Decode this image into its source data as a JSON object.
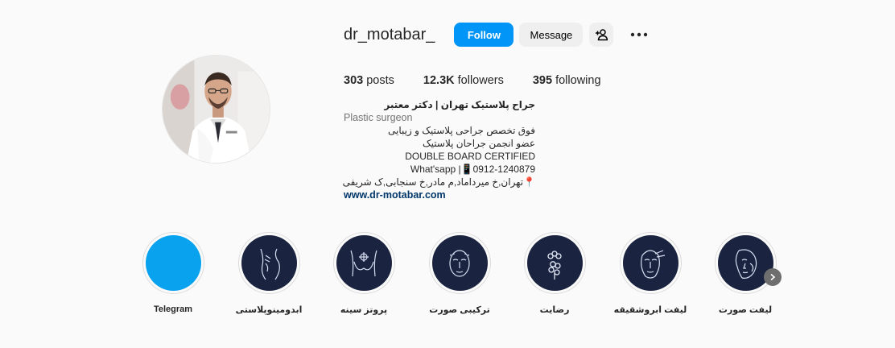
{
  "profile": {
    "username": "dr_motabar_",
    "follow_label": "Follow",
    "message_label": "Message",
    "stats": {
      "posts_count": "303",
      "posts_label": "posts",
      "followers_count": "12.3K",
      "followers_label": "followers",
      "following_count": "395",
      "following_label": "following"
    },
    "bio": {
      "full_name": "جراح پلاستیک تهران | دکتر معتبر",
      "category": "Plastic surgeon",
      "lines": [
        "فوق تخصص جراحی پلاستیک و زیبایی",
        "عضو انجمن جراحان پلاستیک",
        "DOUBLE BOARD CERTIFIED",
        "What'sapp |📱0912-1240879",
        "📍تهران,خ میرداماد,م مادر,خ سنجابی,ک شریفی"
      ],
      "link": "www.dr-motabar.com"
    }
  },
  "highlights": [
    {
      "label": "Telegram",
      "icon": "telegram-highlight-cover"
    },
    {
      "label": "ابدومینوپلاستی",
      "icon": "abdomen-icon"
    },
    {
      "label": "پروتز سینه",
      "icon": "breast-implant-icon"
    },
    {
      "label": "ترکیبی صورت",
      "icon": "face-combo-icon"
    },
    {
      "label": "رضایت",
      "icon": "flower-icon"
    },
    {
      "label": "لیفت ابروشقیقه",
      "icon": "brow-lift-icon"
    },
    {
      "label": "لیفت صورت",
      "icon": "face-lift-icon"
    }
  ],
  "colors": {
    "follow_button": "#0095f6",
    "highlight_cover": "#1a2340",
    "telegram_cover": "#08a2ef",
    "link": "#00376b"
  }
}
